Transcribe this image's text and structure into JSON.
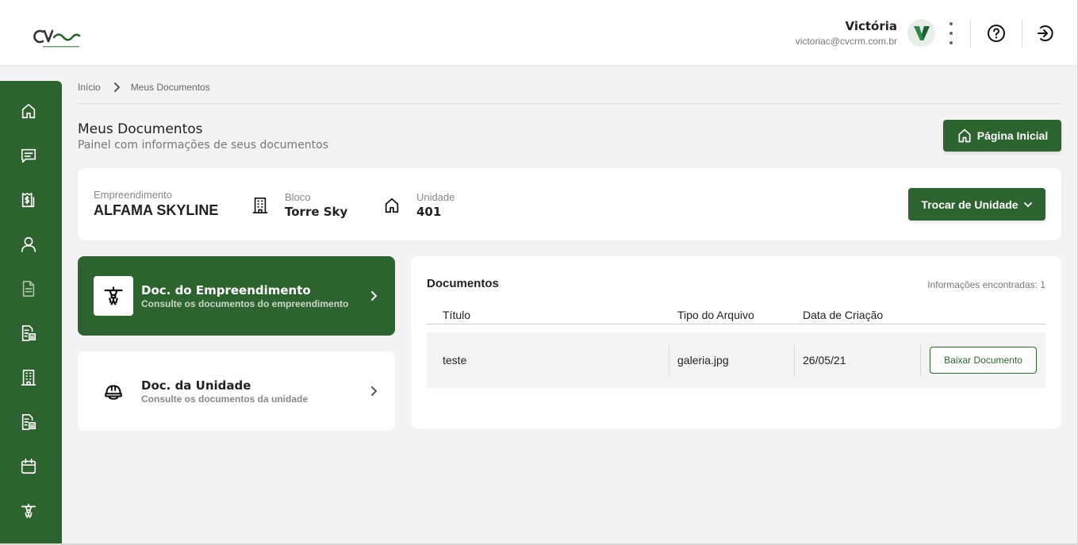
{
  "header": {
    "logo": "logo-cv",
    "user": {
      "name": "Victória",
      "email": "victoriac@cvcrm.com.br"
    },
    "icons": [
      "kebab-menu-icon",
      "help-icon",
      "logout-icon"
    ]
  },
  "sidebar": {
    "items": [
      {
        "name": "home",
        "icon": "home-icon"
      },
      {
        "name": "messages",
        "icon": "chat-icon"
      },
      {
        "name": "finance",
        "icon": "bill-icon"
      },
      {
        "name": "profile",
        "icon": "user-icon"
      },
      {
        "name": "documents",
        "icon": "document-icon",
        "active": true
      },
      {
        "name": "reports",
        "icon": "document-search-icon"
      },
      {
        "name": "building",
        "icon": "building-icon"
      },
      {
        "name": "reports-2",
        "icon": "document-search-icon"
      },
      {
        "name": "calendar",
        "icon": "calendar-icon"
      },
      {
        "name": "construction",
        "icon": "crane-icon"
      }
    ]
  },
  "breadcrumb": {
    "home": "Início",
    "current": "Meus Documentos"
  },
  "page": {
    "title": "Meus Documentos",
    "subtitle": "Painel com informações de seus documentos",
    "home_button": "Página Inicial"
  },
  "unit_info": {
    "empreendimento_label": "Empreendimento",
    "empreendimento_value": "ALFAMA SKYLINE",
    "bloco_label": "Bloco",
    "bloco_value": "Torre Sky",
    "unidade_label": "Unidade",
    "unidade_value": "401",
    "swap_button": "Trocar de Unidade"
  },
  "doc_categories": [
    {
      "title": "Doc. do Empreendimento",
      "subtitle": "Consulte os documentos do empreendimento",
      "icon": "crane-icon",
      "active": true
    },
    {
      "title": "Doc. da Unidade",
      "subtitle": "Consulte os documentos da unidade",
      "icon": "helmet-icon",
      "active": false
    }
  ],
  "documents": {
    "title": "Documentos",
    "count_text": "Informações encontradas: 1",
    "columns": [
      "Título",
      "Tipo do Arquivo",
      "Data de Criação"
    ],
    "rows": [
      {
        "titulo": "teste",
        "tipo": "galeria.jpg",
        "data": "26/05/21",
        "action": "Baixar Documento"
      }
    ]
  },
  "colors": {
    "primary": "#2d632e",
    "background": "#f3f3f4",
    "card": "#ffffff"
  }
}
